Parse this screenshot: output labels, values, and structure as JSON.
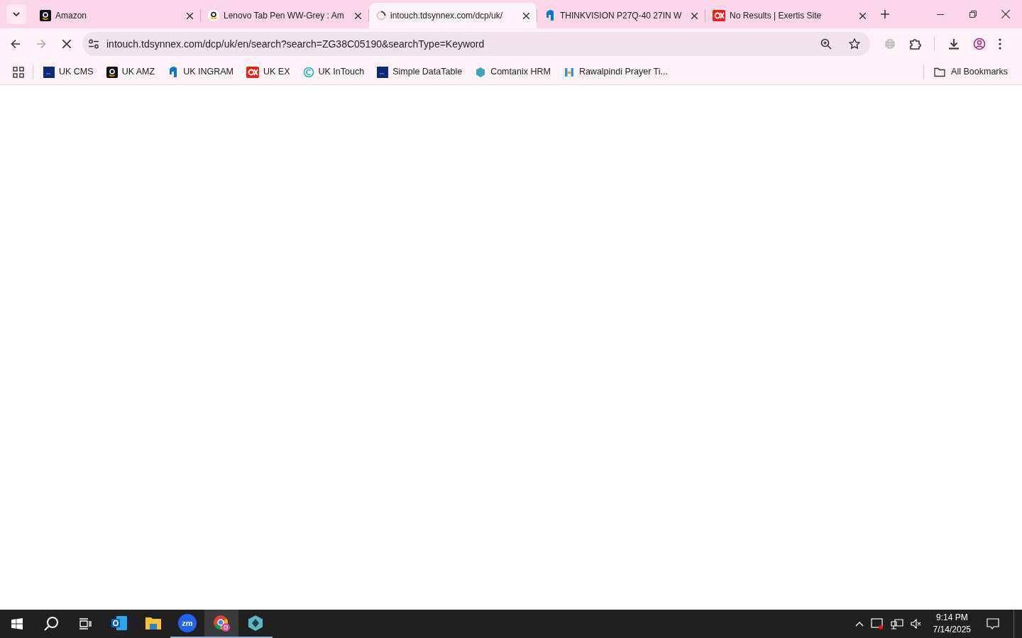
{
  "tabs": [
    {
      "title": "Amazon",
      "kind": "amazon",
      "selected": false
    },
    {
      "title": "Lenovo Tab Pen WW-Grey : Am",
      "kind": "amazon-round",
      "selected": false
    },
    {
      "title": "intouch.tdsynnex.com/dcp/uk/",
      "kind": "loading",
      "selected": true
    },
    {
      "title": "THINKVISION P27Q-40 27IN W",
      "kind": "ingram",
      "selected": false
    },
    {
      "title": "No Results | Exertis Site",
      "kind": "exertis",
      "selected": false
    }
  ],
  "address_bar": {
    "url": "intouch.tdsynnex.com/dcp/uk/en/search?search=ZG38C05190&searchType=Keyword",
    "loading": true
  },
  "bookmarks": [
    {
      "label": "UK CMS",
      "kind": "df"
    },
    {
      "label": "UK AMZ",
      "kind": "amazon"
    },
    {
      "label": "UK INGRAM",
      "kind": "ingram"
    },
    {
      "label": "UK EX",
      "kind": "exertis"
    },
    {
      "label": "UK InTouch",
      "kind": "intouch"
    },
    {
      "label": "Simple DataTable",
      "kind": "df"
    },
    {
      "label": "Comtanix HRM",
      "kind": "hex"
    },
    {
      "label": "Rawalpindi Prayer Ti...",
      "kind": "prayer"
    }
  ],
  "all_bookmarks": "All Bookmarks",
  "taskbar": {
    "apps": [
      {
        "kind": "outlook",
        "running": false,
        "selected": false
      },
      {
        "kind": "files",
        "running": false,
        "selected": false
      },
      {
        "kind": "zoom",
        "label": "zm",
        "running": true,
        "selected": false
      },
      {
        "kind": "chrome",
        "running": true,
        "selected": true
      },
      {
        "kind": "gem",
        "running": true,
        "selected": false
      }
    ],
    "time": "9:14 PM",
    "date": "7/14/2025"
  }
}
